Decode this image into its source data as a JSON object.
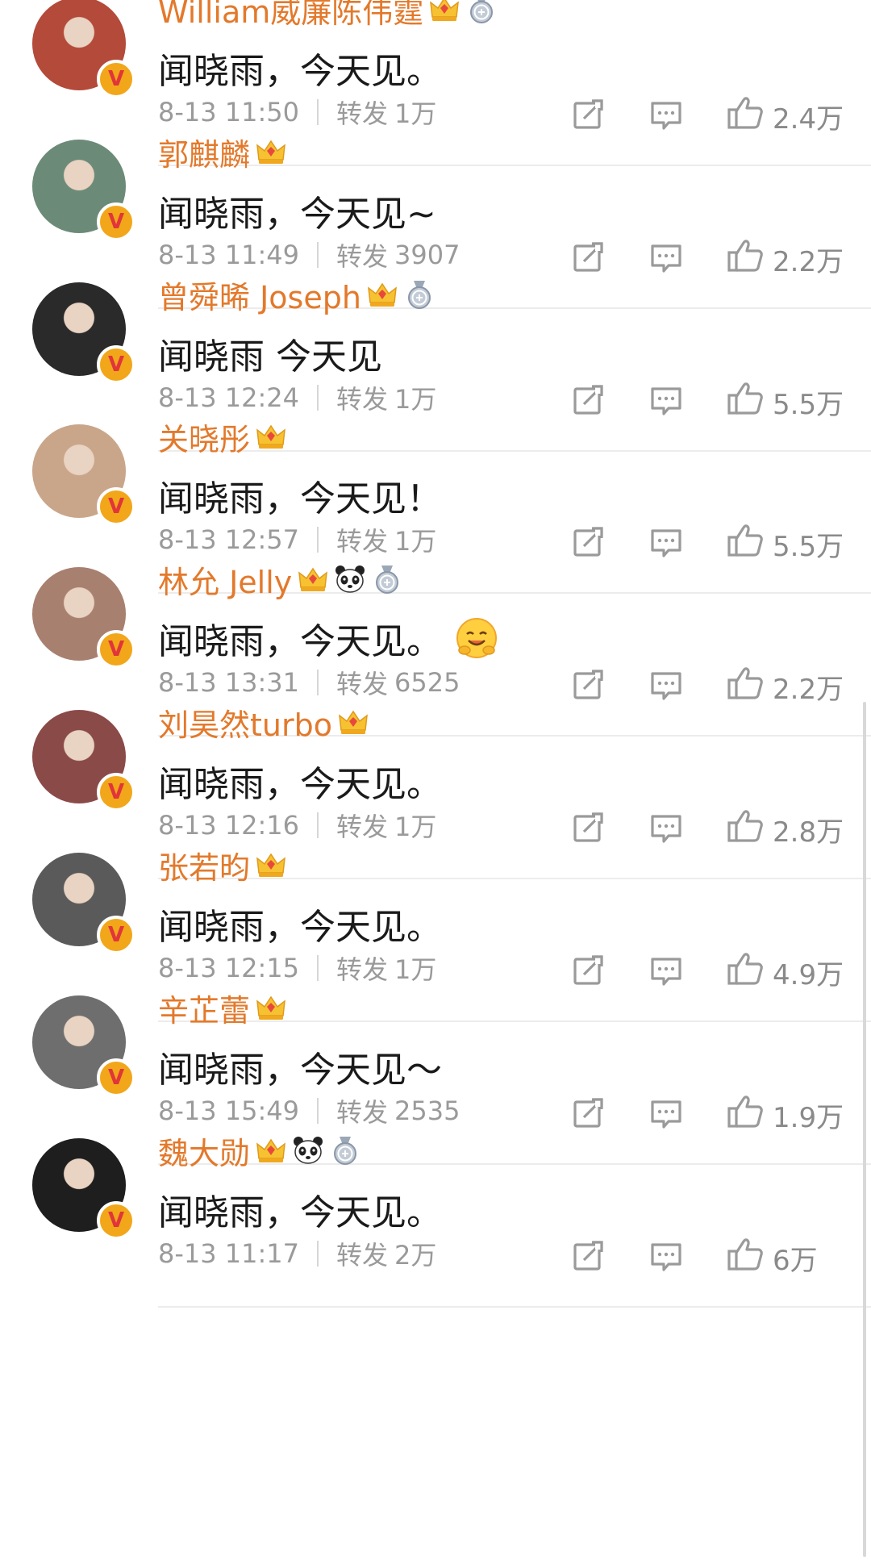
{
  "comments": [
    {
      "name": "William威廉陈伟霆",
      "badges": [
        "crown",
        "medal"
      ],
      "text": "闻晓雨，今天见。",
      "emoji": "",
      "time": "8-13 11:50",
      "repost_label": "转发",
      "reposts": "1万",
      "likes": "2.4万",
      "avatar_color": "#b34a3a"
    },
    {
      "name": "郭麒麟",
      "badges": [
        "crown"
      ],
      "text": "闻晓雨，今天见~",
      "emoji": "",
      "time": "8-13 11:49",
      "repost_label": "转发",
      "reposts": "3907",
      "likes": "2.2万",
      "avatar_color": "#6c8a78"
    },
    {
      "name": "曾舜晞 Joseph",
      "badges": [
        "crown",
        "medal"
      ],
      "text": "闻晓雨 今天见",
      "emoji": "",
      "time": "8-13 12:24",
      "repost_label": "转发",
      "reposts": "1万",
      "likes": "5.5万",
      "avatar_color": "#2a2a2a"
    },
    {
      "name": "关晓彤",
      "badges": [
        "crown"
      ],
      "text": "闻晓雨，今天见！",
      "emoji": "",
      "time": "8-13 12:57",
      "repost_label": "转发",
      "reposts": "1万",
      "likes": "5.5万",
      "avatar_color": "#c9a68a"
    },
    {
      "name": "林允 Jelly",
      "badges": [
        "crown",
        "panda",
        "medal"
      ],
      "text": "闻晓雨，今天见。",
      "emoji": "hug-emoji",
      "time": "8-13 13:31",
      "repost_label": "转发",
      "reposts": "6525",
      "likes": "2.2万",
      "avatar_color": "#a88070"
    },
    {
      "name": "刘昊然turbo",
      "badges": [
        "crown"
      ],
      "text": "闻晓雨，今天见。",
      "emoji": "",
      "time": "8-13 12:16",
      "repost_label": "转发",
      "reposts": "1万",
      "likes": "2.8万",
      "avatar_color": "#8a4a48"
    },
    {
      "name": "张若昀",
      "badges": [
        "crown"
      ],
      "text": "闻晓雨，今天见。",
      "emoji": "",
      "time": "8-13 12:15",
      "repost_label": "转发",
      "reposts": "1万",
      "likes": "4.9万",
      "avatar_color": "#5a5a5a"
    },
    {
      "name": "辛芷蕾",
      "badges": [
        "crown"
      ],
      "text": "闻晓雨，今天见～",
      "emoji": "",
      "time": "8-13 15:49",
      "repost_label": "转发",
      "reposts": "2535",
      "likes": "1.9万",
      "avatar_color": "#6e6e6e"
    },
    {
      "name": "魏大勋",
      "badges": [
        "crown",
        "panda",
        "medal"
      ],
      "text": "闻晓雨，今天见。",
      "emoji": "",
      "time": "8-13 11:17",
      "repost_label": "转发",
      "reposts": "2万",
      "likes": "6万",
      "avatar_color": "#1e1e1e"
    }
  ],
  "colors": {
    "name": "#e3792b",
    "meta": "#9a9a9a",
    "accent_badge": "#f2a619",
    "verify_v": "#e0353a"
  },
  "icons": {
    "share": "share-icon",
    "comment": "comment-icon",
    "like": "like-icon",
    "verified": "verified-v-icon",
    "crown": "crown-badge-icon",
    "medal": "medal-badge-icon",
    "panda": "panda-badge-icon"
  },
  "verified_letter": "V"
}
